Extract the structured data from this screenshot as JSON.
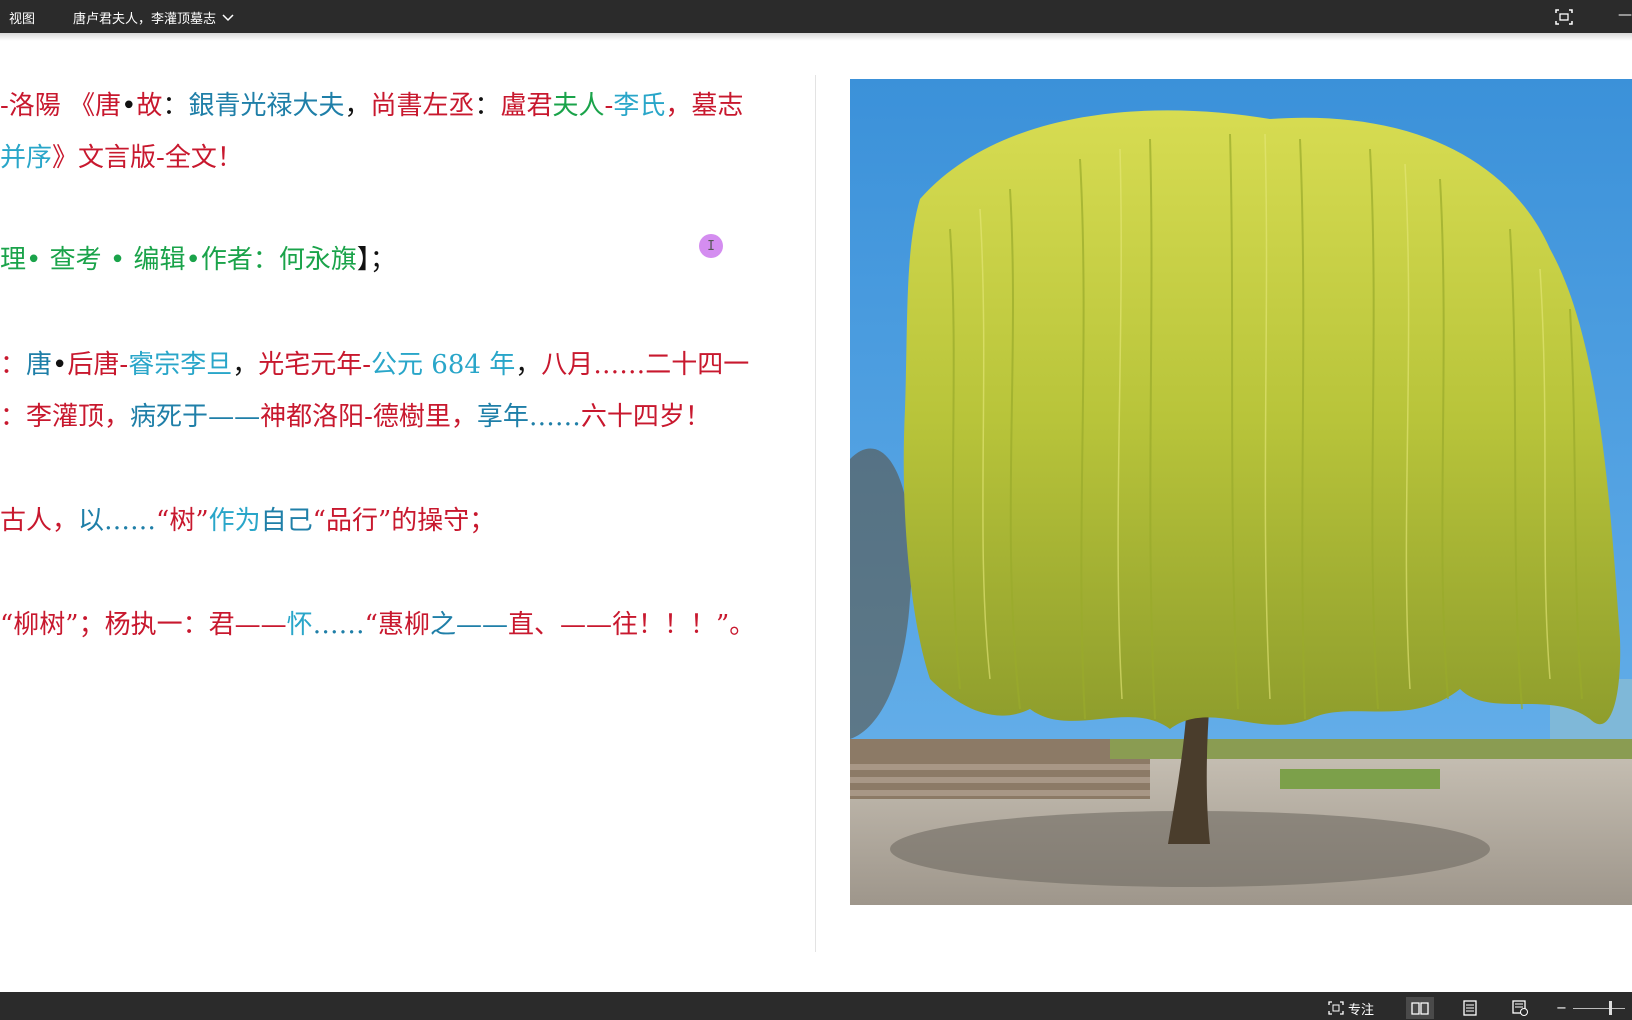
{
  "titlebar": {
    "menu_label": "视图",
    "document_title": "唐卢君夫人，李灌顶墓志"
  },
  "document": {
    "lines": [
      [
        {
          "t": "-洛陽 ",
          "c": "#c8182e"
        },
        {
          "t": "《唐",
          "c": "#c8182e"
        },
        {
          "t": "•",
          "c": "#111111"
        },
        {
          "t": "故",
          "c": "#c8182e"
        },
        {
          "t": "：",
          "c": "#111111"
        },
        {
          "t": "銀青光禄大夫",
          "c": "#1f7fa8"
        },
        {
          "t": "，",
          "c": "#111111"
        },
        {
          "t": "尚書左丞",
          "c": "#c8182e"
        },
        {
          "t": "：",
          "c": "#111111"
        },
        {
          "t": "盧君",
          "c": "#c8182e"
        },
        {
          "t": "夫人",
          "c": "#1aa34a"
        },
        {
          "t": "-",
          "c": "#c8182e"
        },
        {
          "t": "李氏",
          "c": "#29a6c9"
        },
        {
          "t": "，墓志",
          "c": "#c8182e"
        }
      ],
      [
        {
          "t": "并序",
          "c": "#29a6c9"
        },
        {
          "t": "》文言版",
          "c": "#c8182e"
        },
        {
          "t": "-全文",
          "c": "#c8182e"
        },
        {
          "t": "！",
          "c": "#c8182e"
        }
      ],
      [
        {
          "t": "理",
          "c": "#1aa34a"
        },
        {
          "t": "•  ",
          "c": "#1aa34a"
        },
        {
          "t": "查考",
          "c": "#1aa34a"
        },
        {
          "t": " • ",
          "c": "#1aa34a"
        },
        {
          "t": "编辑",
          "c": "#1aa34a"
        },
        {
          "t": "•",
          "c": "#1aa34a"
        },
        {
          "t": "作者：何永旗",
          "c": "#1aa34a"
        },
        {
          "t": "】；",
          "c": "#111111"
        }
      ],
      [
        {
          "t": "：",
          "c": "#c8182e"
        },
        {
          "t": "唐",
          "c": "#1f7fa8"
        },
        {
          "t": "•",
          "c": "#111111"
        },
        {
          "t": "后唐",
          "c": "#c8182e"
        },
        {
          "t": "-",
          "c": "#c8182e"
        },
        {
          "t": "睿宗李旦",
          "c": "#29a6c9"
        },
        {
          "t": "，",
          "c": "#111111"
        },
        {
          "t": "光宅元年",
          "c": "#c8182e"
        },
        {
          "t": "-",
          "c": "#c8182e"
        },
        {
          "t": "公元 ",
          "c": "#29a6c9"
        },
        {
          "t": "684",
          "c": "#29a6c9"
        },
        {
          "t": " 年",
          "c": "#29a6c9"
        },
        {
          "t": "，",
          "c": "#111111"
        },
        {
          "t": "八月……二十四一",
          "c": "#c8182e"
        }
      ],
      [
        {
          "t": "：",
          "c": "#c8182e"
        },
        {
          "t": "李灌顶",
          "c": "#c8182e"
        },
        {
          "t": "，",
          "c": "#c8182e"
        },
        {
          "t": "病死于",
          "c": "#1f7fa8"
        },
        {
          "t": "——",
          "c": "#1f7fa8"
        },
        {
          "t": "神都洛阳",
          "c": "#c8182e"
        },
        {
          "t": "-",
          "c": "#c8182e"
        },
        {
          "t": "德樹里",
          "c": "#c8182e"
        },
        {
          "t": "，",
          "c": "#c8182e"
        },
        {
          "t": "享年",
          "c": "#1f7fa8"
        },
        {
          "t": "……",
          "c": "#1f7fa8"
        },
        {
          "t": "六十四岁！",
          "c": "#c8182e"
        }
      ],
      [
        {
          "t": "古人",
          "c": "#c8182e"
        },
        {
          "t": "，",
          "c": "#c8182e"
        },
        {
          "t": "以……",
          "c": "#1f7fa8"
        },
        {
          "t": "“树”",
          "c": "#c8182e"
        },
        {
          "t": "作为",
          "c": "#29a6c9"
        },
        {
          "t": "自己",
          "c": "#1f7fa8"
        },
        {
          "t": "“品行”",
          "c": "#c8182e"
        },
        {
          "t": "的操守；",
          "c": "#c8182e"
        }
      ],
      [
        {
          "t": "“柳树”",
          "c": "#c8182e"
        },
        {
          "t": "；",
          "c": "#c8182e"
        },
        {
          "t": "杨执一",
          "c": "#c8182e"
        },
        {
          "t": "：",
          "c": "#c8182e"
        },
        {
          "t": "君——",
          "c": "#c8182e"
        },
        {
          "t": "怀",
          "c": "#29a6c9"
        },
        {
          "t": "……",
          "c": "#1f7fa8"
        },
        {
          "t": "“惠柳",
          "c": "#c8182e"
        },
        {
          "t": "之",
          "c": "#1f7fa8"
        },
        {
          "t": "——",
          "c": "#1f7fa8"
        },
        {
          "t": "直、——往！！！”。",
          "c": "#c8182e"
        }
      ]
    ]
  },
  "cursor_glyph": "I",
  "statusbar": {
    "focus_label": "专注"
  }
}
